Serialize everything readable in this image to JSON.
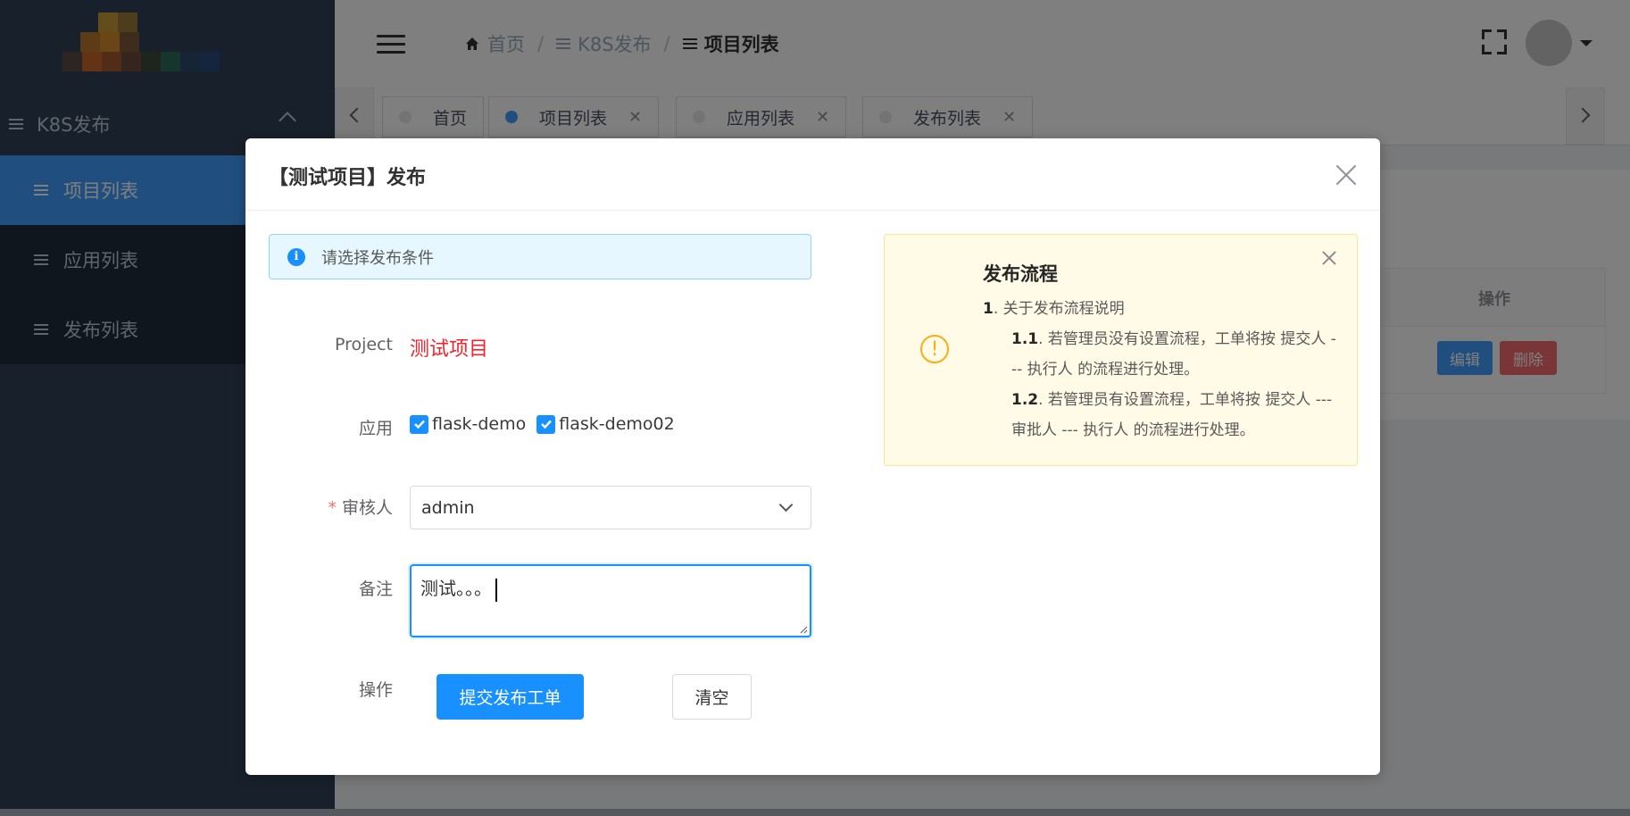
{
  "sidebar": {
    "group_label": "K8S发布",
    "items": [
      {
        "label": "项目列表"
      },
      {
        "label": "应用列表"
      },
      {
        "label": "发布列表"
      }
    ]
  },
  "breadcrumb": {
    "home": "首页",
    "section": "K8S发布",
    "current": "项目列表"
  },
  "tags": [
    {
      "label": "首页"
    },
    {
      "label": "项目列表"
    },
    {
      "label": "应用列表"
    },
    {
      "label": "发布列表"
    }
  ],
  "background_table": {
    "header": "操作",
    "edit_label": "编辑",
    "delete_label": "删除"
  },
  "dialog": {
    "title": "【测试项目】发布",
    "info_text": "请选择发布条件",
    "project_label": "Project",
    "project_value": "测试项目",
    "app_label": "应用",
    "apps": [
      "flask-demo",
      "flask-demo02"
    ],
    "reviewer_label": "审核人",
    "reviewer_value": "admin",
    "remark_label": "备注",
    "remark_value": "测试。。。",
    "action_label": "操作",
    "submit_label": "提交发布工单",
    "clear_label": "清空"
  },
  "process_alert": {
    "title": "发布流程",
    "line1_num": "1",
    "line1_text": ". 关于发布流程说明",
    "line2_num": "1.1",
    "line2_text": ". 若管理员没有设置流程，工单将按 提交人 --- 执行人 的流程进行处理。",
    "line3_num": "1.2",
    "line3_text": ". 若管理员有设置流程，工单将按 提交人 --- 审批人 --- 执行人 的流程进行处理。"
  },
  "colors": {
    "sidebar_bg": "#304156",
    "accent": "#1890ff",
    "danger": "#f5222d",
    "warning": "#faad14"
  }
}
